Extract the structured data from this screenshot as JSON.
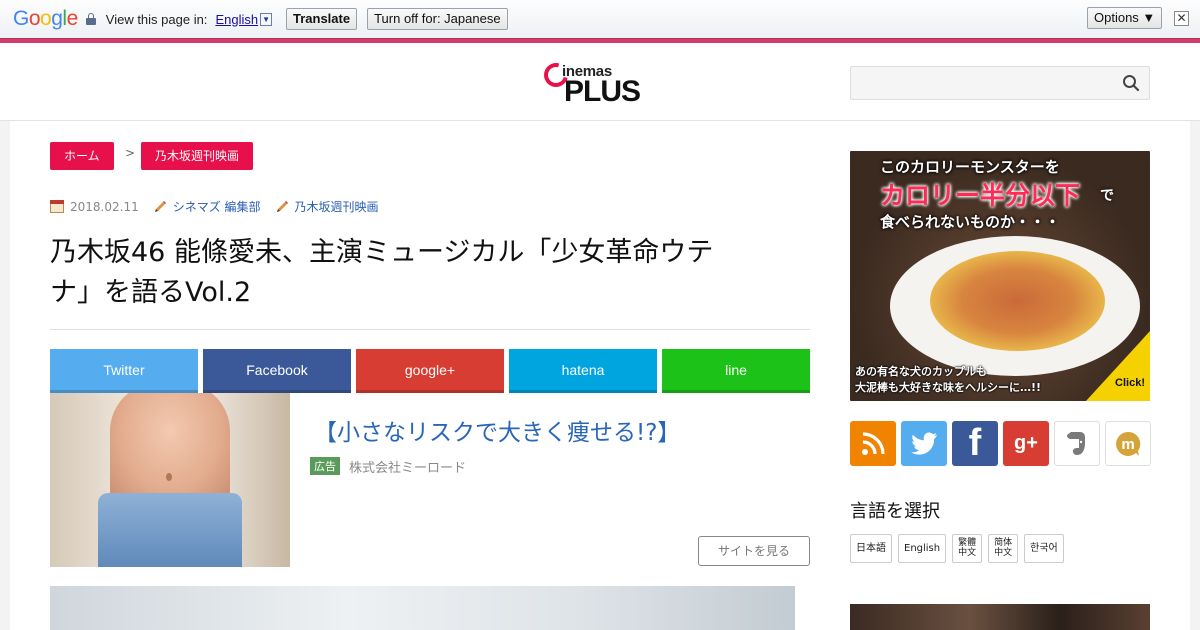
{
  "translate_bar": {
    "google_letters": [
      {
        "ch": "G",
        "color": "#4285F4"
      },
      {
        "ch": "o",
        "color": "#EA4335"
      },
      {
        "ch": "o",
        "color": "#FBBC05"
      },
      {
        "ch": "g",
        "color": "#4285F4"
      },
      {
        "ch": "l",
        "color": "#34A853"
      },
      {
        "ch": "e",
        "color": "#EA4335"
      }
    ],
    "view_label": "View this page in:",
    "language": "English",
    "dropdown_glyph": "▼",
    "translate_button": "Translate",
    "turn_off_button": "Turn off for: Japanese",
    "options_button": "Options ▼",
    "close_glyph": "✕"
  },
  "header": {
    "logo_small": "inemas",
    "logo_big": "PLUS",
    "search_value": ""
  },
  "breadcrumb": {
    "home": "ホーム",
    "separator": ">",
    "category": "乃木坂週刊映画"
  },
  "meta": {
    "date": "2018.02.11",
    "author": "シネマズ 編集部",
    "category": "乃木坂週刊映画"
  },
  "article": {
    "title_line1": "乃木坂46 能條愛未、主演ミュージカル「少女革命ウテ",
    "title_line2": "ナ」を語るVol.2"
  },
  "share_buttons": [
    {
      "label": "Twitter",
      "color": "#55acee"
    },
    {
      "label": "Facebook",
      "color": "#3b5998"
    },
    {
      "label": "google+",
      "color": "#d73d32"
    },
    {
      "label": "hatena",
      "color": "#00a4de"
    },
    {
      "label": "line",
      "color": "#1dc219"
    }
  ],
  "ad": {
    "headline": "【小さなリスクで大きく痩せる!?】",
    "tag": "広告",
    "advertiser": "株式会社ミーロード",
    "visit_button": "サイトを見る"
  },
  "sidebar_banner": {
    "line1": "このカロリーモンスターを",
    "line2": "カロリー半分以下",
    "line2_suffix": "で",
    "line3": "食べられないものか・・・",
    "bottom1": "あの有名な犬のカップルも",
    "bottom2": "大泥棒も大好きな味をヘルシーに…!!",
    "click": "Click!"
  },
  "follow_icons": [
    {
      "name": "rss-icon",
      "color": "#f08300"
    },
    {
      "name": "twitter-icon",
      "color": "#55acee"
    },
    {
      "name": "facebook-icon",
      "color": "#3b5998"
    },
    {
      "name": "googleplus-icon",
      "color": "#d73d32"
    },
    {
      "name": "evernote-icon",
      "color": "#ffffff"
    },
    {
      "name": "mixi-icon",
      "color": "#ffffff"
    }
  ],
  "follow_labels": {
    "facebook": "f",
    "googleplus": "g+",
    "mixi": "m"
  },
  "language_select": {
    "title": "言語を選択",
    "options": [
      {
        "label": "日本語"
      },
      {
        "label": "English"
      },
      {
        "line1": "繁體",
        "line2": "中文"
      },
      {
        "line1": "简体",
        "line2": "中文"
      },
      {
        "label": "한국어"
      }
    ]
  },
  "colors": {
    "accent": "#e8104a",
    "link": "#2a66b8"
  }
}
